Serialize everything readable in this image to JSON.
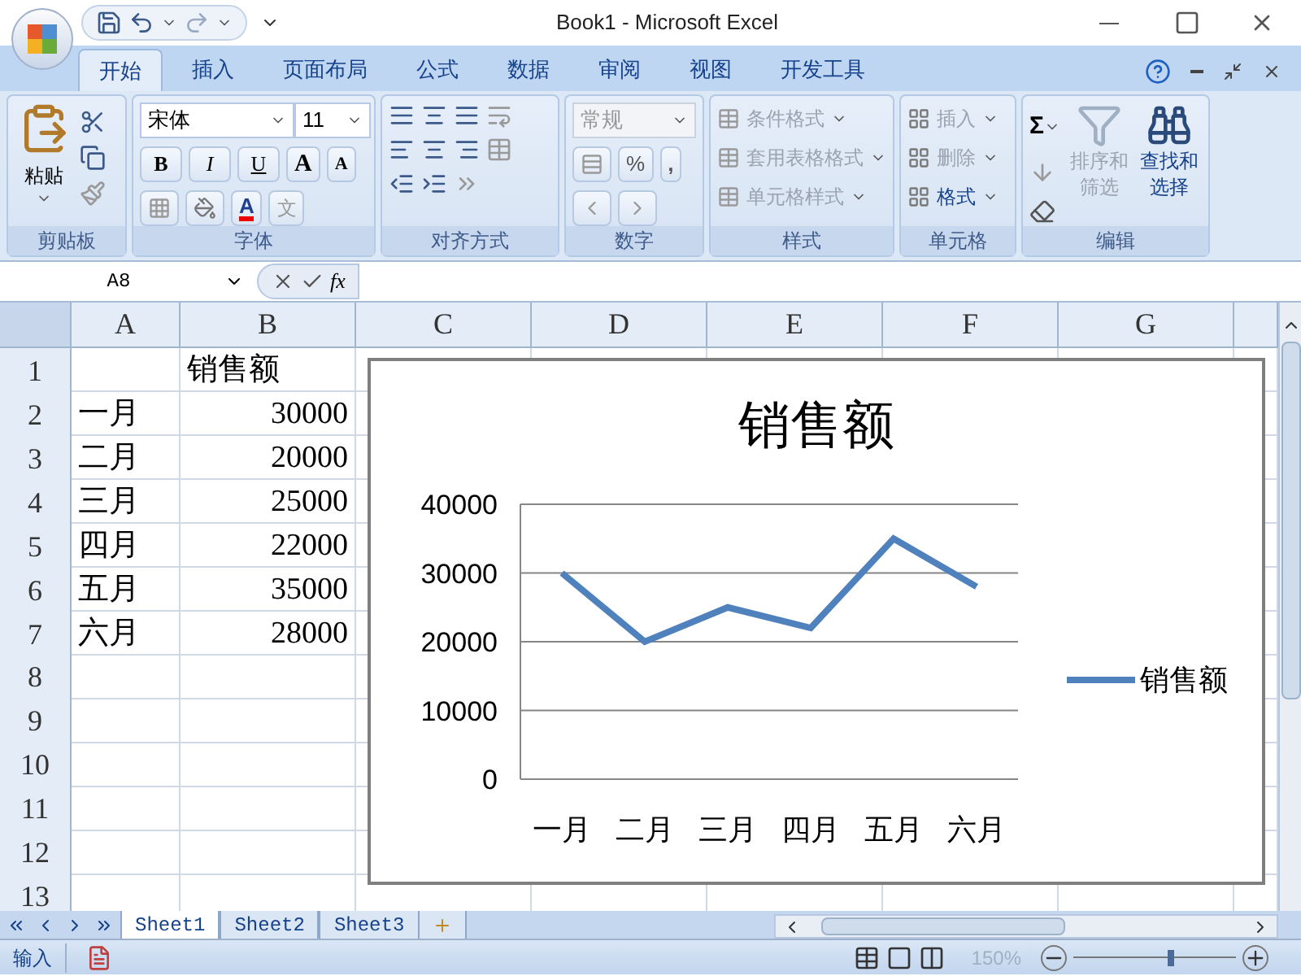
{
  "window": {
    "title": "Book1 - Microsoft Excel"
  },
  "ribbon_tabs": [
    {
      "label": "开始",
      "selected": true
    },
    {
      "label": "插入",
      "selected": false
    },
    {
      "label": "页面布局",
      "selected": false
    },
    {
      "label": "公式",
      "selected": false
    },
    {
      "label": "数据",
      "selected": false
    },
    {
      "label": "审阅",
      "selected": false
    },
    {
      "label": "视图",
      "selected": false
    },
    {
      "label": "开发工具",
      "selected": false
    }
  ],
  "clipboard": {
    "label": "剪贴板",
    "paste": "粘贴"
  },
  "font": {
    "label": "字体",
    "font_name": "宋体",
    "font_size": "11",
    "bold": "B",
    "italic": "I",
    "underline": "U",
    "grow": "A",
    "shrink": "A",
    "font_color_letter": "A",
    "phonetic": "文"
  },
  "alignment": {
    "label": "对齐方式"
  },
  "number": {
    "label": "数字",
    "format": "常规",
    "percent": "%",
    "comma": ","
  },
  "styles": {
    "label": "样式",
    "items": [
      {
        "label": "条件格式",
        "disabled": true
      },
      {
        "label": "套用表格格式",
        "disabled": true
      },
      {
        "label": "单元格样式",
        "disabled": true
      }
    ]
  },
  "cells": {
    "label": "单元格",
    "items": [
      {
        "label": "插入",
        "disabled": true
      },
      {
        "label": "删除",
        "disabled": true
      },
      {
        "label": "格式",
        "disabled": false
      }
    ]
  },
  "editing": {
    "label": "编辑",
    "sum": "Σ",
    "sort": {
      "label": "排序和筛选",
      "disabled": true
    },
    "find": {
      "label": "查找和选择",
      "disabled": false
    }
  },
  "formula_bar": {
    "name_box": "A8",
    "fx": "fx"
  },
  "columns": [
    "A",
    "B",
    "C",
    "D",
    "E",
    "F",
    "G"
  ],
  "rows": [
    {
      "header": "1",
      "b": "销售额"
    },
    {
      "header": "2",
      "a": "一月",
      "b": "30000"
    },
    {
      "header": "3",
      "a": "二月",
      "b": "20000"
    },
    {
      "header": "4",
      "a": "三月",
      "b": "25000"
    },
    {
      "header": "5",
      "a": "四月",
      "b": "22000"
    },
    {
      "header": "6",
      "a": "五月",
      "b": "35000"
    },
    {
      "header": "7",
      "a": "六月",
      "b": "28000"
    },
    {
      "header": "8"
    },
    {
      "header": "9"
    },
    {
      "header": "10"
    },
    {
      "header": "11"
    },
    {
      "header": "12"
    },
    {
      "header": "13"
    }
  ],
  "chart": {
    "chart_data": {
      "type": "line",
      "title": "销售额",
      "categories": [
        "一月",
        "二月",
        "三月",
        "四月",
        "五月",
        "六月"
      ],
      "series": [
        {
          "name": "销售额",
          "color": "#4f81bd",
          "values": [
            30000,
            20000,
            25000,
            22000,
            35000,
            28000
          ]
        }
      ],
      "ylim": [
        0,
        40000
      ],
      "grid": true,
      "yticks": [
        0,
        10000,
        20000,
        30000,
        40000
      ]
    }
  },
  "sheet_tabs": [
    {
      "label": "Sheet1",
      "selected": true
    },
    {
      "label": "Sheet2",
      "selected": false
    },
    {
      "label": "Sheet3",
      "selected": false
    }
  ],
  "status_bar": {
    "mode": "输入",
    "zoom": "150%",
    "zoom_slider": {
      "level": 0.6
    }
  }
}
